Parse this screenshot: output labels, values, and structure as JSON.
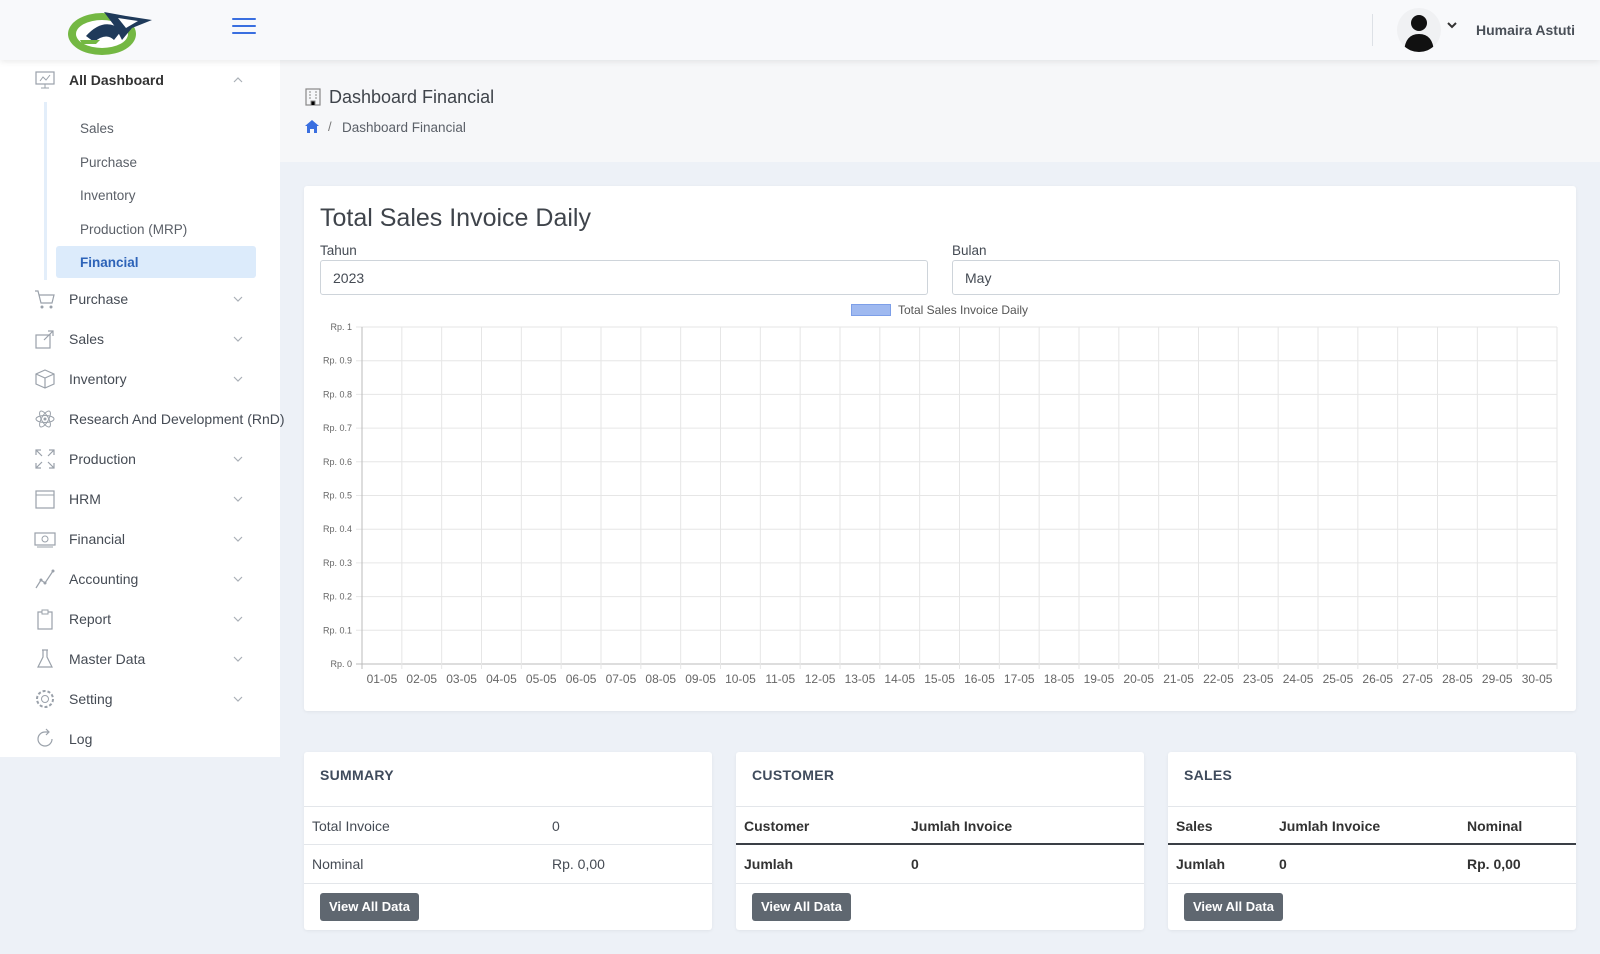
{
  "colors": {
    "accent": "#3a6fe0",
    "sidebar_active_bg": "#dcebfb",
    "legend_fill": "#9fb9f0",
    "button_bg": "#5f6770"
  },
  "header": {
    "user_name": "Humaira Astuti"
  },
  "sidebar": {
    "all_dashboard": {
      "label": "All Dashboard",
      "items": [
        {
          "label": "Sales"
        },
        {
          "label": "Purchase"
        },
        {
          "label": "Inventory"
        },
        {
          "label": "Production (MRP)"
        },
        {
          "label": "Financial",
          "active": true
        }
      ]
    },
    "menu": [
      {
        "label": "Purchase",
        "icon": "cart-icon"
      },
      {
        "label": "Sales",
        "icon": "sales-export-icon"
      },
      {
        "label": "Inventory",
        "icon": "box-icon"
      },
      {
        "label": "Research And Development (RnD)",
        "icon": "atom-icon"
      },
      {
        "label": "Production",
        "icon": "expand-icon"
      },
      {
        "label": "HRM",
        "icon": "calendar-icon"
      },
      {
        "label": "Financial",
        "icon": "money-icon"
      },
      {
        "label": "Accounting",
        "icon": "line-chart-icon"
      },
      {
        "label": "Report",
        "icon": "clipboard-icon"
      },
      {
        "label": "Master Data",
        "icon": "flask-icon"
      },
      {
        "label": "Setting",
        "icon": "gear-icon"
      },
      {
        "label": "Log",
        "icon": "refresh-icon"
      }
    ]
  },
  "page": {
    "title": "Dashboard Financial",
    "breadcrumb": {
      "separator": "/",
      "current": "Dashboard Financial"
    }
  },
  "chart_section": {
    "title": "Total Sales Invoice Daily",
    "year_label": "Tahun",
    "year_value": "2023",
    "month_label": "Bulan",
    "month_value": "May"
  },
  "chart_data": {
    "type": "bar",
    "title": "",
    "categories": [
      "01-05",
      "02-05",
      "03-05",
      "04-05",
      "05-05",
      "06-05",
      "07-05",
      "08-05",
      "09-05",
      "10-05",
      "11-05",
      "12-05",
      "13-05",
      "14-05",
      "15-05",
      "16-05",
      "17-05",
      "18-05",
      "19-05",
      "20-05",
      "21-05",
      "22-05",
      "23-05",
      "24-05",
      "25-05",
      "26-05",
      "27-05",
      "28-05",
      "29-05",
      "30-05"
    ],
    "series": [
      {
        "name": "Total Sales Invoice Daily",
        "values": [
          0,
          0,
          0,
          0,
          0,
          0,
          0,
          0,
          0,
          0,
          0,
          0,
          0,
          0,
          0,
          0,
          0,
          0,
          0,
          0,
          0,
          0,
          0,
          0,
          0,
          0,
          0,
          0,
          0,
          0
        ]
      }
    ],
    "y_ticks": [
      "Rp. 0",
      "Rp. 0.1",
      "Rp. 0.2",
      "Rp. 0.3",
      "Rp. 0.4",
      "Rp. 0.5",
      "Rp. 0.6",
      "Rp. 0.7",
      "Rp. 0.8",
      "Rp. 0.9",
      "Rp. 1"
    ],
    "ylim": [
      0,
      1
    ],
    "grid": true,
    "legend": "top-center"
  },
  "summary": {
    "title": "SUMMARY",
    "rows": [
      {
        "label": "Total Invoice",
        "value": "0"
      },
      {
        "label": "Nominal",
        "value": "Rp. 0,00"
      }
    ],
    "button": "View All Data"
  },
  "customer": {
    "title": "CUSTOMER",
    "headers": [
      "Customer",
      "Jumlah Invoice"
    ],
    "total_row": [
      "Jumlah",
      "0"
    ],
    "button": "View All Data"
  },
  "sales": {
    "title": "SALES",
    "headers": [
      "Sales",
      "Jumlah Invoice",
      "Nominal"
    ],
    "total_row": [
      "Jumlah",
      "0",
      "Rp. 0,00"
    ],
    "button": "View All Data"
  }
}
